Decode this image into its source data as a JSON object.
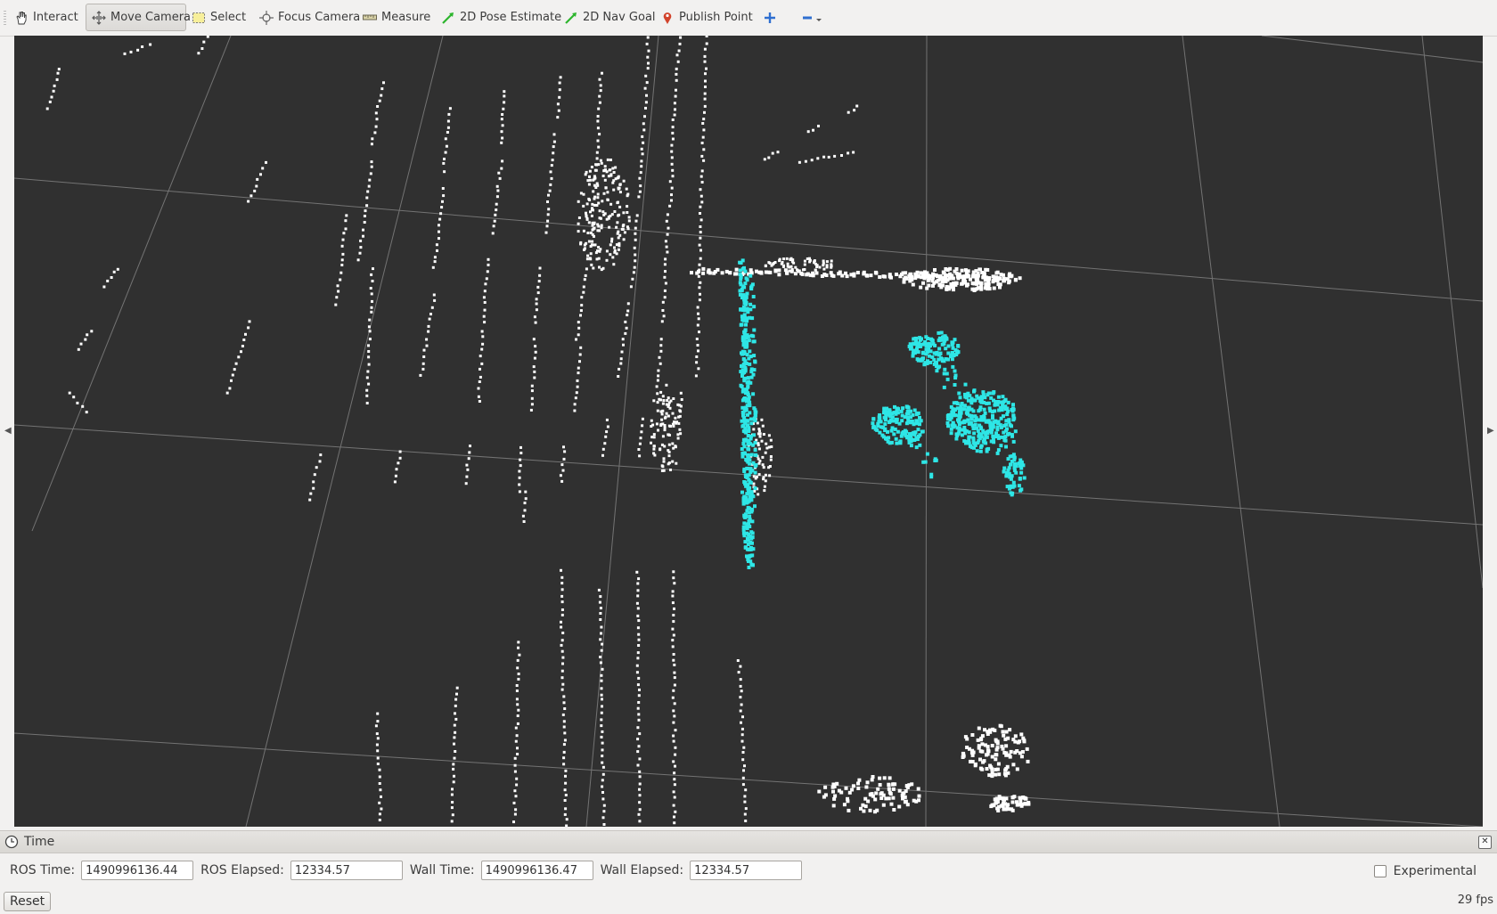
{
  "toolbar": {
    "tools": [
      {
        "label": "Interact",
        "icon": "hand-icon",
        "active": false
      },
      {
        "label": "Move Camera",
        "icon": "move-camera-icon",
        "active": true
      },
      {
        "label": "Select",
        "icon": "select-icon",
        "active": false
      },
      {
        "label": "Focus Camera",
        "icon": "focus-camera-icon",
        "active": false
      },
      {
        "label": "Measure",
        "icon": "ruler-icon",
        "active": false
      },
      {
        "label": "2D Pose Estimate",
        "icon": "green-arrow-icon",
        "active": false
      },
      {
        "label": "2D Nav Goal",
        "icon": "green-arrow-icon",
        "active": false
      },
      {
        "label": "Publish Point",
        "icon": "map-pin-icon",
        "active": false
      }
    ],
    "add_tool_icon": "plus-icon",
    "remove_tool_icon": "minus-dropdown-icon"
  },
  "viewport": {
    "background": "#303030",
    "grid_color": "#8a8a8a",
    "point_color_static": "#ffffff",
    "point_color_highlight": "#2ee6e6"
  },
  "time_panel": {
    "title": "Time",
    "ros_time_label": "ROS Time:",
    "ros_time_value": "1490996136.44",
    "ros_elapsed_label": "ROS Elapsed:",
    "ros_elapsed_value": "12334.57",
    "wall_time_label": "Wall Time:",
    "wall_time_value": "1490996136.47",
    "wall_elapsed_label": "Wall Elapsed:",
    "wall_elapsed_value": "12334.57",
    "experimental_label": "Experimental",
    "experimental_checked": false
  },
  "status": {
    "reset_label": "Reset",
    "fps": "29 fps"
  }
}
